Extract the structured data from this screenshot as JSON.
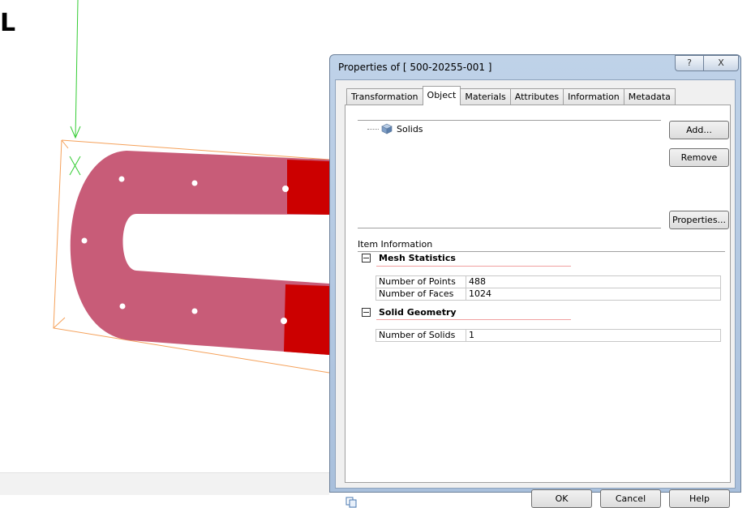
{
  "viewport": {
    "corner_glyph": "L"
  },
  "dialog": {
    "title": "Properties of [ 500-20255-001 ]",
    "title_help_glyph": "?",
    "title_close_glyph": "X",
    "tabs": [
      {
        "label": "Transformation",
        "active": false
      },
      {
        "label": "Object",
        "active": true
      },
      {
        "label": "Materials",
        "active": false
      },
      {
        "label": "Attributes",
        "active": false
      },
      {
        "label": "Information",
        "active": false
      },
      {
        "label": "Metadata",
        "active": false
      }
    ],
    "tree": {
      "items": [
        {
          "label": "Solids",
          "icon": "cube-icon"
        }
      ]
    },
    "buttons": {
      "add": "Add...",
      "remove": "Remove",
      "properties": "Properties...",
      "ok": "OK",
      "cancel": "Cancel",
      "help": "Help"
    },
    "item_information": {
      "label": "Item Information",
      "sections": [
        {
          "title": "Mesh Statistics",
          "rows": [
            {
              "key": "Number of Points",
              "value": "488"
            },
            {
              "key": "Number of Faces",
              "value": "1024"
            }
          ]
        },
        {
          "title": "Solid Geometry",
          "rows": [
            {
              "key": "Number of Solids",
              "value": "1"
            }
          ]
        }
      ]
    }
  },
  "colors": {
    "part_body": "#c85c78",
    "part_end": "#cc0000",
    "bounding_box": "#f5a15a",
    "axis_arrow": "#33cc33"
  }
}
